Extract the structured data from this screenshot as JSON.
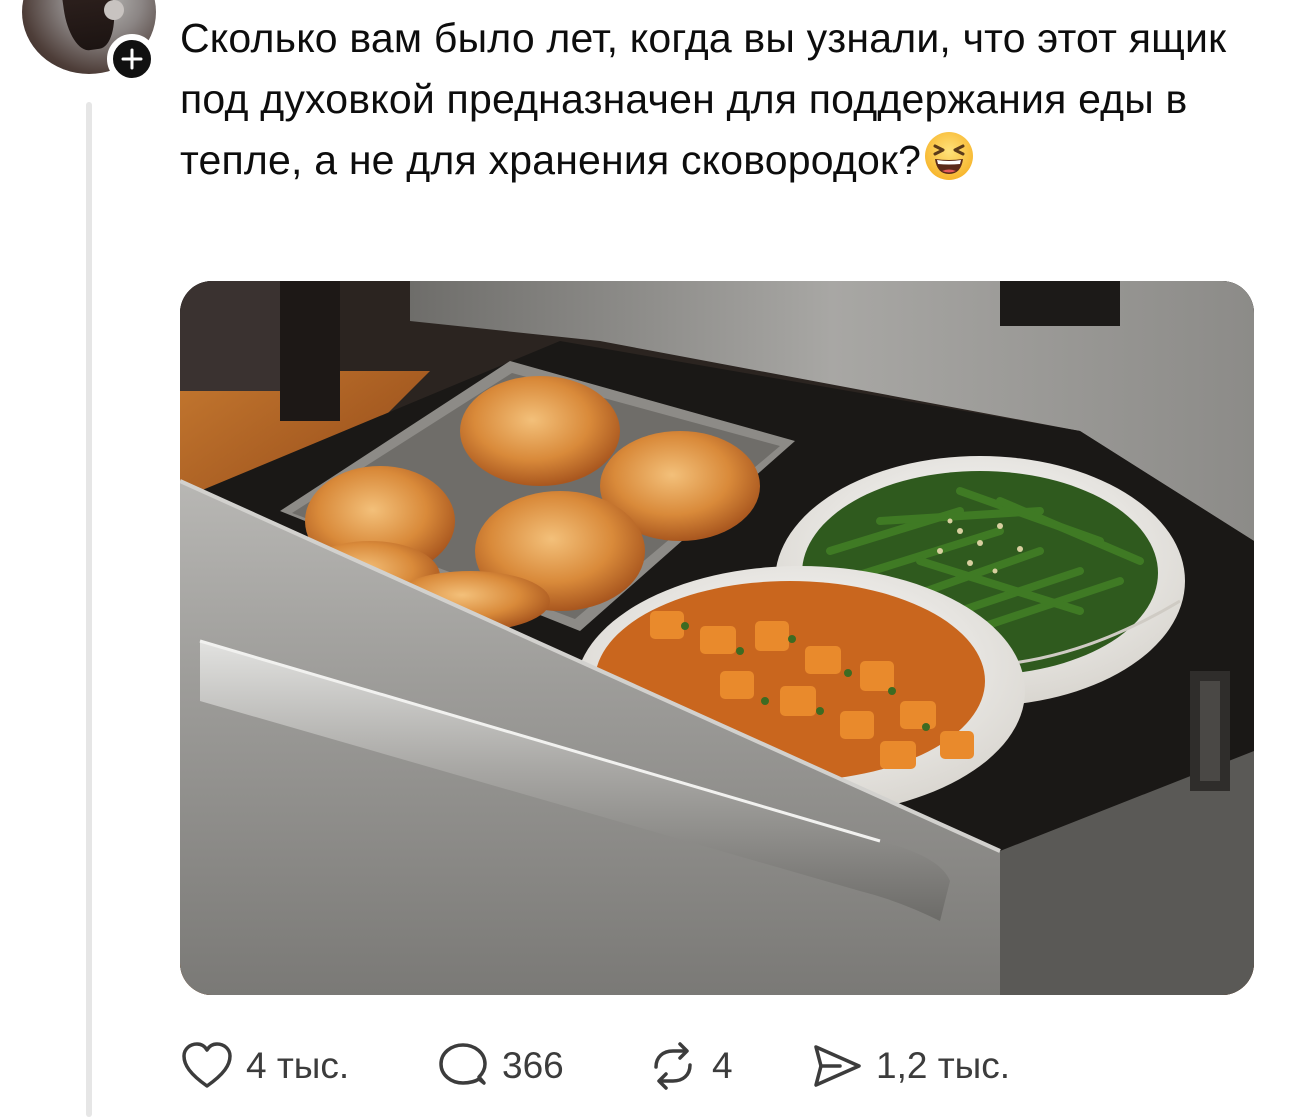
{
  "post": {
    "text": "Сколько вам было лет, когда вы узнали, что этот ящик под духовкой предназначен для поддержания еды в тепле, а не для хранения сковородок?",
    "emoji": "laughing-face-emoji"
  },
  "author": {
    "follow_badge": "+"
  },
  "actions": {
    "likes": "4 тыс.",
    "replies": "366",
    "reposts": "4",
    "shares": "1,2 тыс."
  },
  "icons": {
    "like": "heart-icon",
    "reply": "speech-bubble-icon",
    "repost": "repost-arrows-icon",
    "share": "send-plane-icon"
  },
  "colors": {
    "text": "#0d0d0d",
    "secondary_text": "#3c3c3c",
    "thread_line": "#e6e6e6",
    "badge": "#111111"
  }
}
